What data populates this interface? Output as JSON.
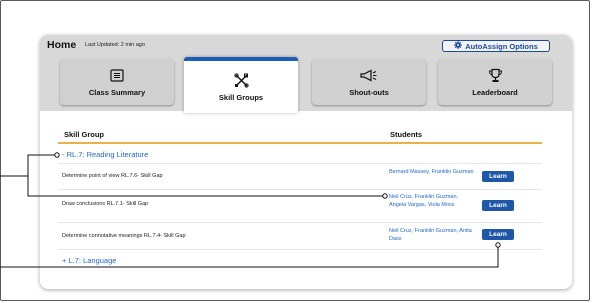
{
  "header": {
    "title": "Home",
    "last_updated": "Last Updated: 2 min ago",
    "autoassign_label": "AutoAssign Options"
  },
  "tabs": [
    {
      "label": "Class Summary",
      "icon": "list-icon",
      "active": false
    },
    {
      "label": "Skill Groups",
      "icon": "tools-icon",
      "active": true
    },
    {
      "label": "Shout-outs",
      "icon": "megaphone-icon",
      "active": false
    },
    {
      "label": "Leaderboard",
      "icon": "trophy-icon",
      "active": false
    }
  ],
  "table": {
    "col_skill": "Skill Group",
    "col_students": "Students",
    "group1": "- RL.7: Reading Literature",
    "rows": [
      {
        "skill": "Determine point of view RL.7.6- Skill Gap",
        "students": "Bernard Massey, Franklin Guzman",
        "action": "Learn"
      },
      {
        "skill": "Draw conclusions RL.7.1- Skill Gap",
        "students": "Neil Cruz, Franklin Guzman, Angela Vargas, Viola Moss",
        "action": "Learn"
      },
      {
        "skill": "Determine connotative meanings RL.7.4- Skill Gap",
        "students": "Neil Cruz, Franklin Guzman, Anita Dass",
        "action": "Learn"
      }
    ],
    "group2": "+ L.7: Language"
  },
  "colors": {
    "accent": "#1a5fb4",
    "link": "#2468c4",
    "learn_button": "#1f57a8",
    "header_rule": "#e8b24a",
    "card_top_bg": "#d8d8d8"
  }
}
